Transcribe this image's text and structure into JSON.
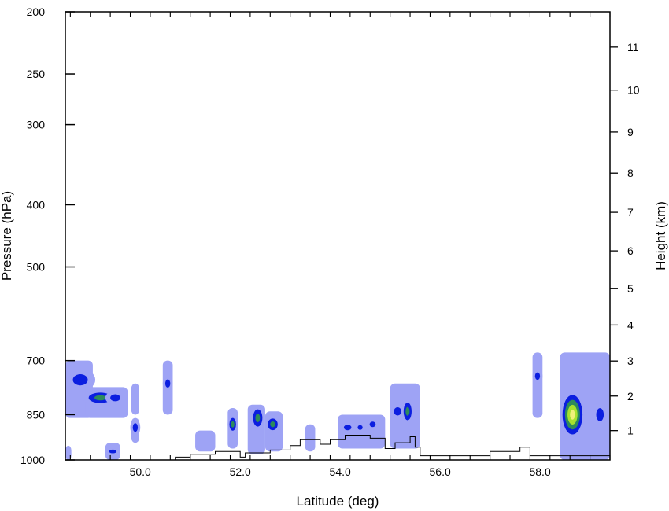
{
  "chart_data": {
    "type": "contour",
    "xlabel": "Latitude (deg)",
    "ylabel_left": "Pressure (hPa)",
    "ylabel_right": "Height (km)",
    "xlim": [
      48.5,
      59.4
    ],
    "ylim_pressure": [
      1000,
      200
    ],
    "y_scale": "log-pressure",
    "x_ticks": [
      "50.0",
      "52.0",
      "54.0",
      "56.0",
      "58.0"
    ],
    "x_tick_values": [
      50,
      52,
      54,
      56,
      58
    ],
    "left_ticks": [
      200,
      250,
      300,
      400,
      500,
      700,
      850,
      1000
    ],
    "right_ticks": [
      1,
      2,
      3,
      4,
      5,
      6,
      7,
      8,
      9,
      10,
      11
    ],
    "right_tick_pressures": [
      900,
      795,
      701,
      616,
      540,
      472,
      411,
      357,
      308,
      265,
      227
    ],
    "contour_colors": [
      "#9ea3f5",
      "#0b1ee0",
      "#2d8a5c",
      "#a6e22e",
      "#f0f07a"
    ],
    "cells": [
      {
        "lat": 48.8,
        "p": 750,
        "dlat": 0.3,
        "dp": 60,
        "levels": 2
      },
      {
        "lat": 49.2,
        "p": 800,
        "dlat": 0.35,
        "dp": 45,
        "levels": 3
      },
      {
        "lat": 49.5,
        "p": 800,
        "dlat": 0.2,
        "dp": 40,
        "levels": 2
      },
      {
        "lat": 49.45,
        "p": 970,
        "dlat": 0.15,
        "dp": 25,
        "levels": 2
      },
      {
        "lat": 49.9,
        "p": 890,
        "dlat": 0.1,
        "dp": 55,
        "levels": 2
      },
      {
        "lat": 50.55,
        "p": 760,
        "dlat": 0.1,
        "dp": 45,
        "levels": 2
      },
      {
        "lat": 51.85,
        "p": 880,
        "dlat": 0.1,
        "dp": 60,
        "levels": 3
      },
      {
        "lat": 52.35,
        "p": 860,
        "dlat": 0.14,
        "dp": 80,
        "levels": 3
      },
      {
        "lat": 52.65,
        "p": 880,
        "dlat": 0.15,
        "dp": 55,
        "levels": 3
      },
      {
        "lat": 54.15,
        "p": 890,
        "dlat": 0.15,
        "dp": 35,
        "levels": 2
      },
      {
        "lat": 54.4,
        "p": 890,
        "dlat": 0.1,
        "dp": 30,
        "levels": 2
      },
      {
        "lat": 54.65,
        "p": 880,
        "dlat": 0.12,
        "dp": 35,
        "levels": 2
      },
      {
        "lat": 55.15,
        "p": 840,
        "dlat": 0.15,
        "dp": 50,
        "levels": 2
      },
      {
        "lat": 55.35,
        "p": 840,
        "dlat": 0.12,
        "dp": 80,
        "levels": 3
      },
      {
        "lat": 57.95,
        "p": 740,
        "dlat": 0.1,
        "dp": 40,
        "levels": 2
      },
      {
        "lat": 58.65,
        "p": 850,
        "dlat": 0.25,
        "dp": 150,
        "levels": 5
      },
      {
        "lat": 59.2,
        "p": 850,
        "dlat": 0.15,
        "dp": 80,
        "levels": 2
      }
    ],
    "light_regions": [
      {
        "lat0": 48.5,
        "lat1": 49.05,
        "p0": 700,
        "p1": 860
      },
      {
        "lat0": 48.9,
        "lat1": 49.75,
        "p0": 770,
        "p1": 860
      },
      {
        "lat0": 48.5,
        "lat1": 48.62,
        "p0": 950,
        "p1": 1000
      },
      {
        "lat0": 49.3,
        "lat1": 49.6,
        "p0": 940,
        "p1": 1000
      },
      {
        "lat0": 49.82,
        "lat1": 49.98,
        "p0": 760,
        "p1": 850
      },
      {
        "lat0": 49.82,
        "lat1": 49.98,
        "p0": 860,
        "p1": 940
      },
      {
        "lat0": 50.45,
        "lat1": 50.65,
        "p0": 700,
        "p1": 850
      },
      {
        "lat0": 51.1,
        "lat1": 51.5,
        "p0": 900,
        "p1": 970
      },
      {
        "lat0": 51.75,
        "lat1": 51.95,
        "p0": 830,
        "p1": 960
      },
      {
        "lat0": 52.15,
        "lat1": 52.5,
        "p0": 820,
        "p1": 980
      },
      {
        "lat0": 52.5,
        "lat1": 52.85,
        "p0": 840,
        "p1": 970
      },
      {
        "lat0": 53.3,
        "lat1": 53.5,
        "p0": 880,
        "p1": 970
      },
      {
        "lat0": 53.95,
        "lat1": 54.9,
        "p0": 850,
        "p1": 960
      },
      {
        "lat0": 55.0,
        "lat1": 55.6,
        "p0": 760,
        "p1": 960
      },
      {
        "lat0": 57.85,
        "lat1": 58.05,
        "p0": 680,
        "p1": 860
      },
      {
        "lat0": 58.4,
        "lat1": 59.4,
        "p0": 680,
        "p1": 1000
      }
    ],
    "terrain": [
      {
        "lat": 50.7,
        "p": 1000
      },
      {
        "lat": 50.7,
        "p": 990
      },
      {
        "lat": 51.0,
        "p": 990
      },
      {
        "lat": 51.0,
        "p": 980
      },
      {
        "lat": 51.5,
        "p": 980
      },
      {
        "lat": 51.5,
        "p": 970
      },
      {
        "lat": 52.0,
        "p": 970
      },
      {
        "lat": 52.0,
        "p": 990
      },
      {
        "lat": 52.1,
        "p": 990
      },
      {
        "lat": 52.1,
        "p": 975
      },
      {
        "lat": 52.6,
        "p": 975
      },
      {
        "lat": 52.6,
        "p": 965
      },
      {
        "lat": 53.0,
        "p": 965
      },
      {
        "lat": 53.0,
        "p": 950
      },
      {
        "lat": 53.2,
        "p": 950
      },
      {
        "lat": 53.2,
        "p": 930
      },
      {
        "lat": 53.6,
        "p": 930
      },
      {
        "lat": 53.6,
        "p": 945
      },
      {
        "lat": 53.8,
        "p": 945
      },
      {
        "lat": 53.8,
        "p": 930
      },
      {
        "lat": 54.1,
        "p": 930
      },
      {
        "lat": 54.1,
        "p": 915
      },
      {
        "lat": 54.6,
        "p": 915
      },
      {
        "lat": 54.6,
        "p": 925
      },
      {
        "lat": 54.9,
        "p": 925
      },
      {
        "lat": 54.9,
        "p": 960
      },
      {
        "lat": 55.1,
        "p": 960
      },
      {
        "lat": 55.1,
        "p": 940
      },
      {
        "lat": 55.4,
        "p": 940
      },
      {
        "lat": 55.4,
        "p": 920
      },
      {
        "lat": 55.5,
        "p": 920
      },
      {
        "lat": 55.5,
        "p": 955
      },
      {
        "lat": 55.6,
        "p": 955
      },
      {
        "lat": 55.6,
        "p": 985
      },
      {
        "lat": 57.0,
        "p": 985
      },
      {
        "lat": 57.0,
        "p": 970
      },
      {
        "lat": 57.6,
        "p": 970
      },
      {
        "lat": 57.6,
        "p": 955
      },
      {
        "lat": 57.8,
        "p": 955
      },
      {
        "lat": 57.8,
        "p": 985
      },
      {
        "lat": 59.4,
        "p": 985
      }
    ]
  }
}
